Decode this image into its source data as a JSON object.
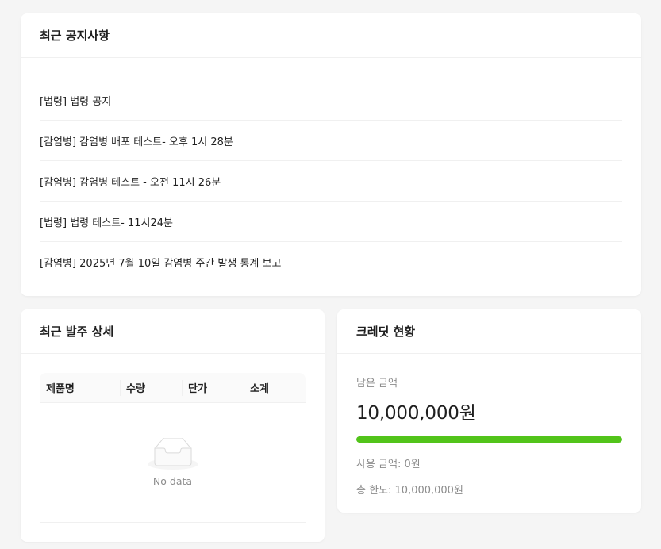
{
  "notices": {
    "title": "최근 공지사항",
    "items": [
      "[법령] 법령 공지",
      "[감염병] 감염병 배포 테스트- 오후 1시 28분",
      "[감염병] 감염병 테스트 - 오전 11시 26분",
      "[법령] 법령 테스트- 11시24분",
      "[감염병] 2025년 7월 10일 감염병 주간 발생 통계 보고"
    ]
  },
  "orders": {
    "title": "최근 발주 상세",
    "columns": [
      "제품명",
      "수량",
      "단가",
      "소계"
    ],
    "empty_text": "No data",
    "empty_icon": "empty-inbox-icon"
  },
  "credit": {
    "title": "크레딧 현황",
    "remaining_label": "남은 금액",
    "remaining_amount": "10,000,000원",
    "remaining_ratio": 1.0,
    "bar_color": "#52c41a",
    "used_text": "사용 금액: 0원",
    "limit_text": "총 한도: 10,000,000원"
  }
}
